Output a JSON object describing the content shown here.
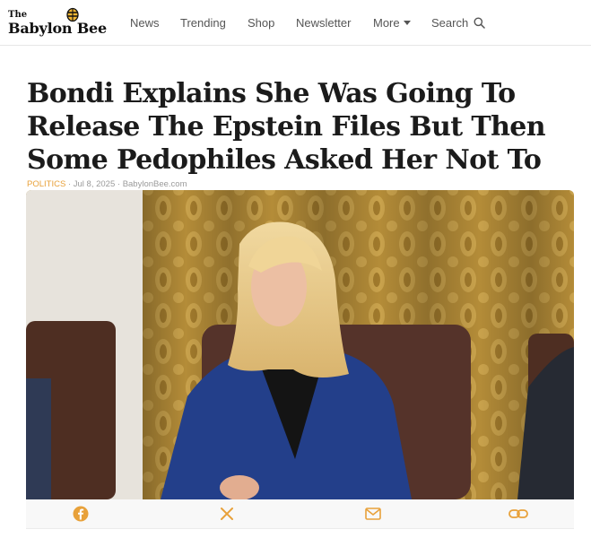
{
  "site": {
    "logo_small": "The",
    "logo_big": "Babylon Bee"
  },
  "nav": {
    "items": [
      "News",
      "Trending",
      "Shop",
      "Newsletter"
    ],
    "more_label": "More",
    "search_label": "Search"
  },
  "article": {
    "headline": "Bondi Explains She Was Going To Release The Epstein Files But Then Some Pedophiles Asked Her Not To",
    "category": "POLITICS",
    "date": "Jul 8, 2025",
    "source": "BabylonBee.com"
  },
  "share": {
    "buttons": [
      "facebook-icon",
      "x-icon",
      "email-icon",
      "link-icon"
    ]
  },
  "colors": {
    "accent": "#e8a13a",
    "headline": "#1b1b1b",
    "nav_text": "#555555"
  }
}
